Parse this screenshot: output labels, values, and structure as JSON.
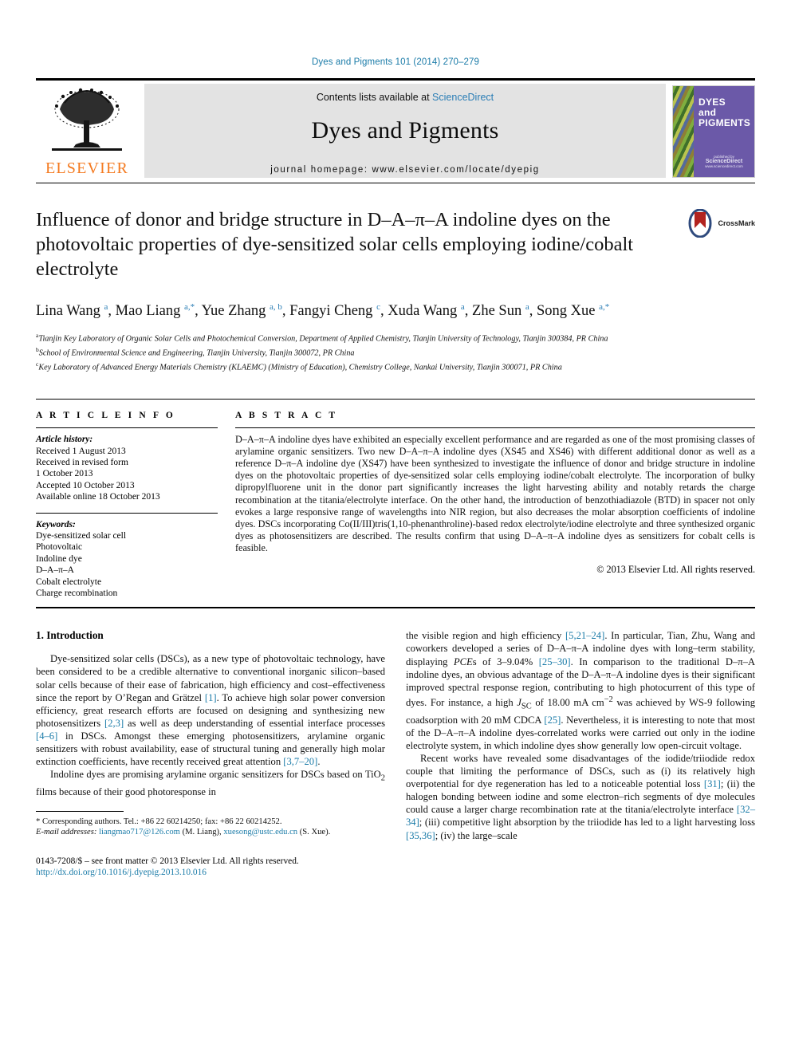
{
  "running_head": "Dyes and Pigments 101 (2014) 270–279",
  "masthead": {
    "publisher_logo_name": "elsevier-tree-logo",
    "publisher_wordmark": "ELSEVIER",
    "contents_prefix": "Contents lists available at ",
    "contents_link": "ScienceDirect",
    "journal_title": "Dyes and Pigments",
    "homepage": "journal homepage: www.elsevier.com/locate/dyepig",
    "cover": {
      "line1": "DYES",
      "line2": "and",
      "line3": "PIGMENTS",
      "footer_small": "published by",
      "footer_big": "ScienceDirect",
      "footer_url": "www.sciencedirect.com"
    }
  },
  "article": {
    "title": "Influence of donor and bridge structure in D–A–π–A indoline dyes on the photovoltaic properties of dye-sensitized solar cells employing iodine/cobalt electrolyte",
    "crossmark_label": "CrossMark",
    "authors_html": "Lina Wang <sup>a</sup>, Mao Liang <sup>a,*</sup>, Yue Zhang <sup>a, b</sup>, Fangyi Cheng <sup>c</sup>, Xuda Wang <sup>a</sup>, Zhe Sun <sup>a</sup>, Song Xue <sup>a,*</sup>",
    "affiliations": [
      {
        "marker": "a",
        "text": "Tianjin Key Laboratory of Organic Solar Cells and Photochemical Conversion, Department of Applied Chemistry, Tianjin University of Technology, Tianjin 300384, PR China"
      },
      {
        "marker": "b",
        "text": "School of Environmental Science and Engineering, Tianjin University, Tianjin 300072, PR China"
      },
      {
        "marker": "c",
        "text": "Key Laboratory of Advanced Energy Materials Chemistry (KLAEMC) (Ministry of Education), Chemistry College, Nankai University, Tianjin 300071, PR China"
      }
    ]
  },
  "article_info": {
    "heading": "A R T I C L E   I N F O",
    "history_label": "Article history:",
    "history": [
      "Received 1 August 2013",
      "Received in revised form",
      "1 October 2013",
      "Accepted 10 October 2013",
      "Available online 18 October 2013"
    ],
    "keywords_label": "Keywords:",
    "keywords": [
      "Dye-sensitized solar cell",
      "Photovoltaic",
      "Indoline dye",
      "D–A–π–A",
      "Cobalt electrolyte",
      "Charge recombination"
    ]
  },
  "abstract": {
    "heading": "A B S T R A C T",
    "text": "D–A–π–A indoline dyes have exhibited an especially excellent performance and are regarded as one of the most promising classes of arylamine organic sensitizers. Two new D–A–π–A indoline dyes (XS45 and XS46) with different additional donor as well as a reference D–π–A indoline dye (XS47) have been synthesized to investigate the influence of donor and bridge structure in indoline dyes on the photovoltaic properties of dye-sensitized solar cells employing iodine/cobalt electrolyte. The incorporation of bulky dipropylfluorene unit in the donor part significantly increases the light harvesting ability and notably retards the charge recombination at the titania/electrolyte interface. On the other hand, the introduction of benzothiadiazole (BTD) in spacer not only evokes a large responsive range of wavelengths into NIR region, but also decreases the molar absorption coefficients of indoline dyes. DSCs incorporating Co(II/III)tris(1,10-phenanthroline)-based redox electrolyte/iodine electrolyte and three synthesized organic dyes as photosensitizers are described. The results confirm that using D–A–π–A indoline dyes as sensitizers for cobalt cells is feasible.",
    "copyright": "© 2013 Elsevier Ltd. All rights reserved."
  },
  "body": {
    "section_heading": "1. Introduction",
    "left_paragraphs": [
      "Dye-sensitized solar cells (DSCs), as a new type of photovoltaic technology, have been considered to be a credible alternative to conventional inorganic silicon–based solar cells because of their ease of fabrication, high efficiency and cost–effectiveness since the report by O’Regan and Grätzel [1]. To achieve high solar power conversion efficiency, great research efforts are focused on designing and synthesizing new photosensitizers [2,3] as well as deep understanding of essential interface processes [4–6] in DSCs. Amongst these emerging photosensitizers, arylamine organic sensitizers with robust availability, ease of structural tuning and generally high molar extinction coefficients, have recently received great attention [3,7–20].",
      "Indoline dyes are promising arylamine organic sensitizers for DSCs based on TiO2 films because of their good photoresponse in"
    ],
    "right_paragraphs": [
      "the visible region and high efficiency [5,21–24]. In particular, Tian, Zhu, Wang and coworkers developed a series of D–A–π–A indoline dyes with long–term stability, displaying PCEs of 3–9.04% [25–30]. In comparison to the traditional D–π–A indoline dyes, an obvious advantage of the D–A–π–A indoline dyes is their significant improved spectral response region, contributing to high photocurrent of this type of dyes. For instance, a high JSC of 18.00 mA cm−2 was achieved by WS-9 following coadsorption with 20 mM CDCA [25]. Nevertheless, it is interesting to note that most of the D–A–π–A indoline dyes-correlated works were carried out only in the iodine electrolyte system, in which indoline dyes show generally low open-circuit voltage.",
      "Recent works have revealed some disadvantages of the iodide/triiodide redox couple that limiting the performance of DSCs, such as (i) its relatively high overpotential for dye regeneration has led to a noticeable potential loss [31]; (ii) the halogen bonding between iodine and some electron–rich segments of dye molecules could cause a larger charge recombination rate at the titania/electrolyte interface [32–34]; (iii) competitive light absorption by the triiodide has led to a light harvesting loss [35,36]; (iv) the large–scale"
    ]
  },
  "footnote": {
    "corresponding": "* Corresponding authors. Tel.: +86 22 60214250; fax: +86 22 60214252.",
    "email_label": "E-mail addresses:",
    "email1": "liangmao717@126.com",
    "email1_owner": "(M. Liang),",
    "email2": "xuesong@ustc.edu.cn",
    "email2_owner": "(S. Xue)."
  },
  "imprint": {
    "line1": "0143-7208/$ – see front matter © 2013 Elsevier Ltd. All rights reserved.",
    "doi": "http://dx.doi.org/10.1016/j.dyepig.2013.10.016"
  },
  "colors": {
    "link": "#1a7ba8",
    "elsevier_orange": "#f47a20",
    "cover_purple": "#6b59a8",
    "banner_gray": "#e3e3e3"
  }
}
